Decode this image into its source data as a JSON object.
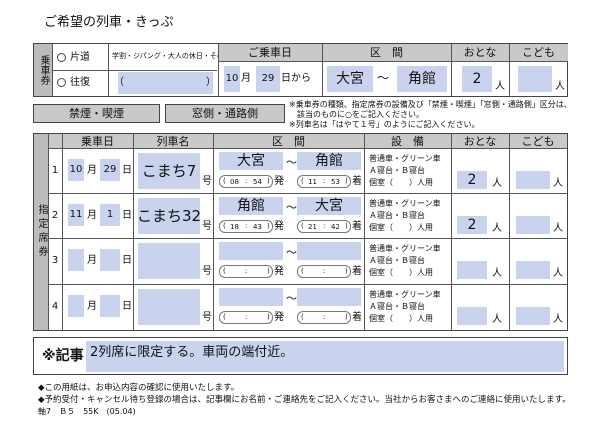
{
  "form": {
    "title": "ご希望の列車・きっぷ",
    "ticket": {
      "row_label": "乗車券",
      "katamichi": "片道",
      "oufuku": "往復",
      "discount_note": "学割・ジパング・大人の休日・その他",
      "headers": {
        "date": "ご乗車日",
        "section": "区　間",
        "adult": "おとな",
        "child": "こども"
      },
      "month": "10",
      "day": "29",
      "month_unit": "月",
      "day_unit": "日から",
      "from": "大宮",
      "tilde": "～",
      "to": "角館",
      "adults": "2",
      "unit_person": "人"
    },
    "option_boxes": {
      "smoking": "禁煙・喫煙",
      "seat": "窓側・通路側"
    },
    "notes": [
      "※乗車券の種類、指定席券の設備及び「禁煙・喫煙」「窓側・通路側」区分は、",
      "　該当のものに○をご記入ください。",
      "※列車名は「はやて１号」のようにご記入ください。"
    ],
    "reserved": {
      "side_label": "指定席券",
      "headers": {
        "date": "乗車日",
        "train": "列車名",
        "section": "区　間",
        "facility": "設　備",
        "adult": "おとな",
        "child": "こども"
      },
      "units": {
        "month": "月",
        "day": "日",
        "go": "号",
        "dep": "発",
        "arr": "着",
        "person": "人"
      },
      "facility_lines": [
        "普通車・グリーン車",
        "Ａ寝台・Ｂ寝台",
        "個室（　　）人用"
      ],
      "rows": [
        {
          "no": "1",
          "month": "10",
          "day": "29",
          "train": "こまち7",
          "from": "大宮",
          "to": "角館",
          "dep_h": "08",
          "dep_m": "54",
          "arr_h": "11",
          "arr_m": "53",
          "adults": "2"
        },
        {
          "no": "2",
          "month": "11",
          "day": "1",
          "train": "こまち32",
          "from": "角館",
          "to": "大宮",
          "dep_h": "18",
          "dep_m": "43",
          "arr_h": "21",
          "arr_m": "42",
          "adults": "2"
        },
        {
          "no": "3",
          "month": "",
          "day": "",
          "train": "",
          "from": "",
          "to": "",
          "dep_h": "",
          "dep_m": "",
          "arr_h": "",
          "arr_m": "",
          "adults": ""
        },
        {
          "no": "4",
          "month": "",
          "day": "",
          "train": "",
          "from": "",
          "to": "",
          "dep_h": "",
          "dep_m": "",
          "arr_h": "",
          "arr_m": "",
          "adults": ""
        }
      ]
    },
    "remarks": {
      "label": "※記事",
      "text": "2列席に限定する。車両の端付近。"
    },
    "footer": [
      "◆この用紙は、お申込内容の確認に使用いたします。",
      "◆予約受付・キャンセル待ち登録の場合は、記事欄にお名前・ご連絡先をご記入ください。当社からお客さまへのご連絡に使用いたします。"
    ],
    "code": "軸7　Ｂ５　55K　(05.04)"
  }
}
